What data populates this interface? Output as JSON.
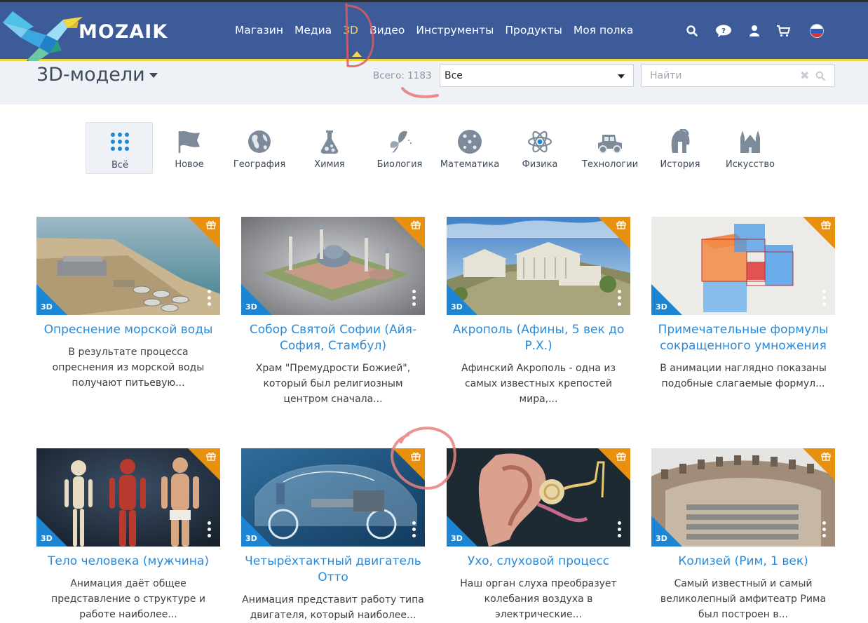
{
  "header": {
    "logo_text": "MOZAIK",
    "nav": [
      "Магазин",
      "Медиа",
      "3D",
      "Видео",
      "Инструменты",
      "Продукты",
      "Моя полка"
    ],
    "active_nav": "3D",
    "icons": [
      "search-icon",
      "help-chat-icon",
      "user-icon",
      "cart-icon",
      "language-flag-icon"
    ],
    "language": "ru"
  },
  "subbar": {
    "title": "3D-модели",
    "total_label": "Всего: 1183",
    "filter_value": "Все",
    "search_placeholder": "Найти"
  },
  "categories": [
    {
      "label": "Всё",
      "icon": "grid-icon"
    },
    {
      "label": "Новое",
      "icon": "flag-icon"
    },
    {
      "label": "География",
      "icon": "globe-icon"
    },
    {
      "label": "Химия",
      "icon": "flask-icon"
    },
    {
      "label": "Биология",
      "icon": "butterfly-icon"
    },
    {
      "label": "Математика",
      "icon": "dice-icon"
    },
    {
      "label": "Физика",
      "icon": "atom-icon"
    },
    {
      "label": "Технологии",
      "icon": "car-icon"
    },
    {
      "label": "История",
      "icon": "helmet-icon"
    },
    {
      "label": "Искусство",
      "icon": "church-icon"
    }
  ],
  "active_category": "Всё",
  "cards": [
    {
      "title": "Опреснение морской воды",
      "desc": "В результате процесса опреснения из морской воды получают питьевую...",
      "badge": "3D"
    },
    {
      "title": "Собор Святой Софии (Айя-София, Стамбул)",
      "desc": "Храм \"Премудрости Божией\", который был религиозным центром сначала...",
      "badge": "3D"
    },
    {
      "title": "Акрополь (Афины, 5 век до Р.Х.)",
      "desc": "Афинский Акрополь - одна из самых известных крепостей мира,...",
      "badge": "3D"
    },
    {
      "title": "Примечательные формулы сокращенного умножения",
      "desc": "В анимации наглядно показаны подобные слагаемые формул...",
      "badge": "3D"
    },
    {
      "title": "Тело человека (мужчина)",
      "desc": "Анимация даёт общее представление о структуре и работе наиболее...",
      "badge": "3D"
    },
    {
      "title": "Четырёхтактный двигатель Отто",
      "desc": "Анимация представит работу типа двигателя, который наиболее...",
      "badge": "3D"
    },
    {
      "title": "Ухо, слуховой процесс",
      "desc": "Наш орган слуха преобразует колебания воздуха в электрические...",
      "badge": "3D"
    },
    {
      "title": "Колизей (Рим, 1 век)",
      "desc": "Самый известный и самый великолепный амфитеатр Рима был построен в...",
      "badge": "3D"
    }
  ],
  "colors": {
    "header_bg": "#3d5a99",
    "accent_yellow": "#f2d64b",
    "link_blue": "#2b8ad8",
    "badge_blue": "#1c86d4",
    "gift_orange": "#e8910f",
    "annotation_red": "#e05a5a"
  }
}
